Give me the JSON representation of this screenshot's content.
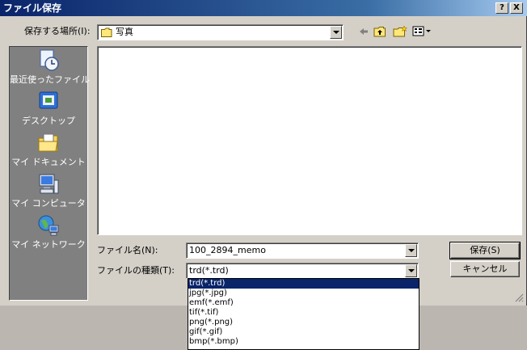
{
  "title": "ファイル保存",
  "title_buttons": {
    "help": "?",
    "close": "X"
  },
  "location": {
    "label": "保存する場所(I):",
    "value": "写真"
  },
  "places": [
    {
      "label": "最近使ったファイル",
      "icon": "recent-documents-icon"
    },
    {
      "label": "デスクトップ",
      "icon": "desktop-icon"
    },
    {
      "label": "マイ ドキュメント",
      "icon": "my-documents-icon"
    },
    {
      "label": "マイ コンピュータ",
      "icon": "my-computer-icon"
    },
    {
      "label": "マイ ネットワーク",
      "icon": "my-network-icon"
    }
  ],
  "filename": {
    "label": "ファイル名(N):",
    "value": "100_2894_memo"
  },
  "filetype": {
    "label": "ファイルの種類(T):",
    "value": "trd(*.trd)"
  },
  "buttons": {
    "save": "保存(S)",
    "cancel": "キャンセル"
  },
  "filetype_options": [
    "trd(*.trd)",
    "jpg(*.jpg)",
    "emf(*.emf)",
    "tif(*.tif)",
    "png(*.png)",
    "gif(*.gif)",
    "bmp(*.bmp)"
  ],
  "selected_option": "trd(*.trd)",
  "colors": {
    "titlebar": "#0a246a",
    "selection": "#0a246a",
    "face": "#d4d0c8",
    "places_bg": "#808080"
  }
}
